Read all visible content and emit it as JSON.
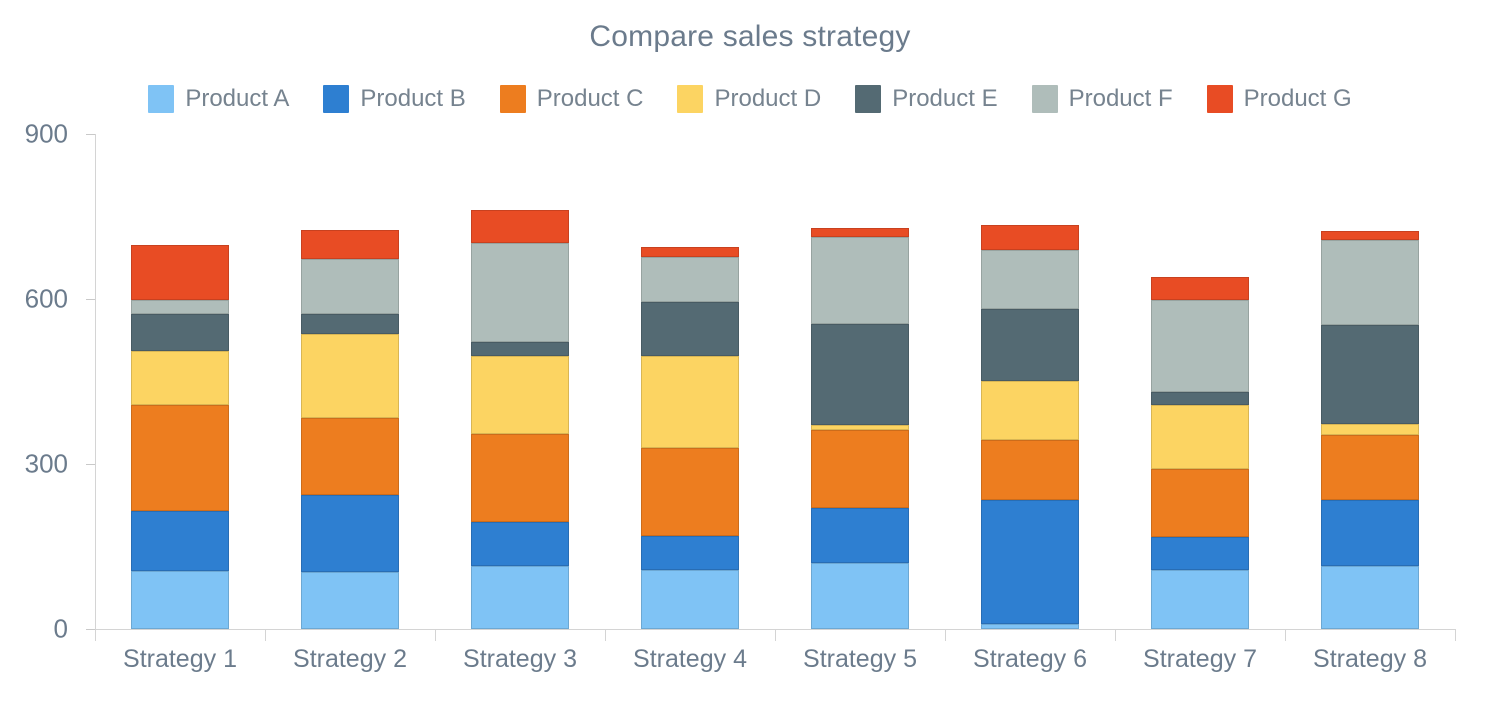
{
  "chart_data": {
    "type": "bar",
    "stacked": true,
    "title": "Compare sales strategy",
    "xlabel": "",
    "ylabel": "",
    "ylim": [
      0,
      900
    ],
    "yticks": [
      0,
      300,
      600,
      900
    ],
    "grid": false,
    "legend_position": "top",
    "categories": [
      "Strategy 1",
      "Strategy 2",
      "Strategy 3",
      "Strategy 4",
      "Strategy 5",
      "Strategy 6",
      "Strategy 7",
      "Strategy 8"
    ],
    "series": [
      {
        "name": "Product A",
        "color": "#7FC3F5",
        "values": [
          105,
          104,
          115,
          107,
          120,
          10,
          107,
          115
        ]
      },
      {
        "name": "Product B",
        "color": "#2E7FD1",
        "values": [
          109,
          140,
          80,
          62,
          100,
          225,
          60,
          120
        ]
      },
      {
        "name": "Product C",
        "color": "#ED7D1F",
        "values": [
          193,
          140,
          160,
          160,
          142,
          109,
          124,
          118
        ]
      },
      {
        "name": "Product D",
        "color": "#FCD462",
        "values": [
          98,
          153,
          142,
          167,
          9,
          107,
          116,
          20
        ]
      },
      {
        "name": "Product E",
        "color": "#546A73",
        "values": [
          67,
          35,
          25,
          98,
          184,
          131,
          24,
          180
        ]
      },
      {
        "name": "Product F",
        "color": "#AFBDBA",
        "values": [
          27,
          100,
          180,
          82,
          158,
          107,
          167,
          155
        ]
      },
      {
        "name": "Product G",
        "color": "#E84C24",
        "values": [
          100,
          53,
          60,
          18,
          16,
          45,
          42,
          16
        ]
      }
    ],
    "totals": [
      699,
      725,
      762,
      694,
      729,
      734,
      640,
      724
    ]
  }
}
